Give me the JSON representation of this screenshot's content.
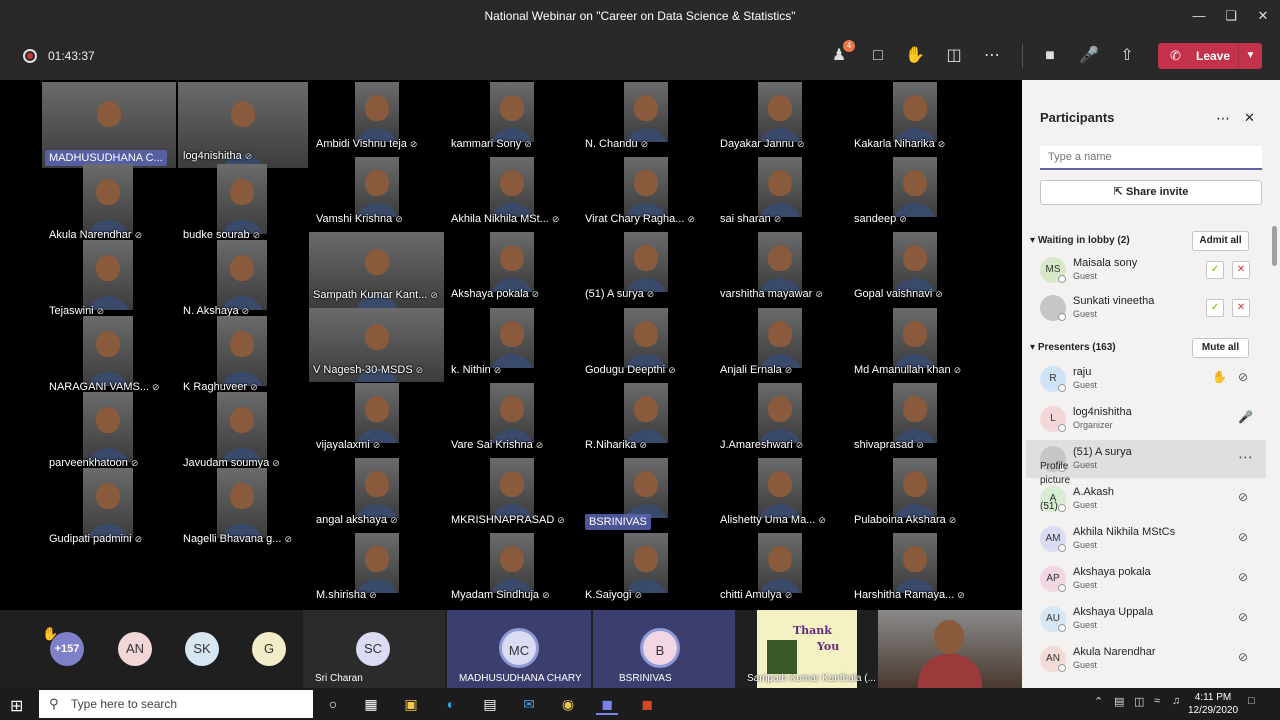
{
  "window": {
    "title": "National Webinar on \"Career on Data Science & Statistics\""
  },
  "toolbar": {
    "timer": "01:43:37",
    "participants_badge": "4",
    "leave_label": "Leave"
  },
  "gallery": {
    "names": [
      "MADHUSUDHANA C...",
      "log4nishitha",
      "Ambidi Vishnu teja",
      "kammari Sony",
      "N. Chandu",
      "Dayakar Jannu",
      "Kakarla Niharika",
      "Akula Narendhar",
      "budke sourab",
      "Vamshi Krishna",
      "Akhila Nikhila MSt...",
      "Virat Chary Ragha...",
      "sai sharan",
      "sandeep",
      "Tejaswini",
      "N. Akshaya",
      "Sampath Kumar Kant...",
      "Akshaya pokala",
      "(51) A surya",
      "varshitha mayawar",
      "Gopal vaishnavi",
      "NARAGANI VAMS...",
      "K Raghuveer",
      "V Nagesh-30-MSDS",
      "k. Nithin",
      "Godugu Deepthi",
      "Anjali Ernala",
      "Md Amanullah khan",
      "parveenkhatoon",
      "Javudam soumya",
      "vijayalaxmi",
      "Vare Sai Krishna",
      "R.Niharika",
      "J.Amareshwari",
      "shivaprasad",
      "Gudipati padmini",
      "Nagelli Bhavana g...",
      "angal akshaya",
      "MKRISHNAPRASAD",
      "BSRINIVAS",
      "Alishetty Uma Ma...",
      "Pulaboina Akshara",
      "M.shirisha",
      "Myadam Sindhuja",
      "K.Saiyogi",
      "chitti Amulya",
      "Harshitha Ramaya..."
    ]
  },
  "bottom": {
    "overflow": "+157",
    "avatars": [
      "AN",
      "SK",
      "G"
    ],
    "sri": {
      "initials": "SC",
      "name": "Sri Charan"
    },
    "madhu": {
      "initials": "MC",
      "name": "MADHUSUDHANA CHARY"
    },
    "bsri": {
      "initials": "B",
      "name": "BSRINIVAS"
    },
    "thank": {
      "line1": "Thank",
      "line2": "You",
      "name": "Sampath Kumar Kanthala (..."
    }
  },
  "panel": {
    "title": "Participants",
    "search_placeholder": "Type a name",
    "share_label": "Share invite",
    "lobby_header": "Waiting in lobby (2)",
    "admit_all": "Admit all",
    "presenters_header": "Presenters (163)",
    "mute_all": "Mute all",
    "lobby": [
      {
        "initials": "MS",
        "name": "Maisala sony",
        "role": "Guest",
        "color": "#d7e8c8"
      },
      {
        "initials": "",
        "name": "Sunkati vineetha",
        "role": "Guest",
        "color": "#c8c6c4"
      }
    ],
    "presenters": [
      {
        "initials": "R",
        "name": "raju",
        "role": "Guest",
        "color": "#cfe3f7"
      },
      {
        "initials": "L",
        "name": "log4nishitha",
        "role": "Organizer",
        "color": "#f3d6d8"
      },
      {
        "initials": "",
        "name": "(51) A surya",
        "role": "Guest",
        "color": "#c8c6c4"
      },
      {
        "initials": "A",
        "name": "A.Akash",
        "role": "Guest",
        "color": "#d7ecd0"
      },
      {
        "initials": "AM",
        "name": "Akhila Nikhila MStCs",
        "role": "Guest",
        "color": "#d9dcf3"
      },
      {
        "initials": "AP",
        "name": "Akshaya pokala",
        "role": "Guest",
        "color": "#f3d6e4"
      },
      {
        "initials": "AU",
        "name": "Akshaya Uppala",
        "role": "Guest",
        "color": "#d6e6f3"
      },
      {
        "initials": "AN",
        "name": "Akula Narendhar",
        "role": "Guest",
        "color": "#f3dcd6"
      }
    ],
    "overlay": {
      "l1": "Profile",
      "l2": "picture",
      "l3": "(51)"
    }
  },
  "taskbar": {
    "search": "Type here to search",
    "time": "4:11 PM",
    "date": "12/29/2020"
  },
  "colors": {
    "accent": "#6264a7",
    "leave": "#c4314b",
    "chrome": "#292929"
  }
}
